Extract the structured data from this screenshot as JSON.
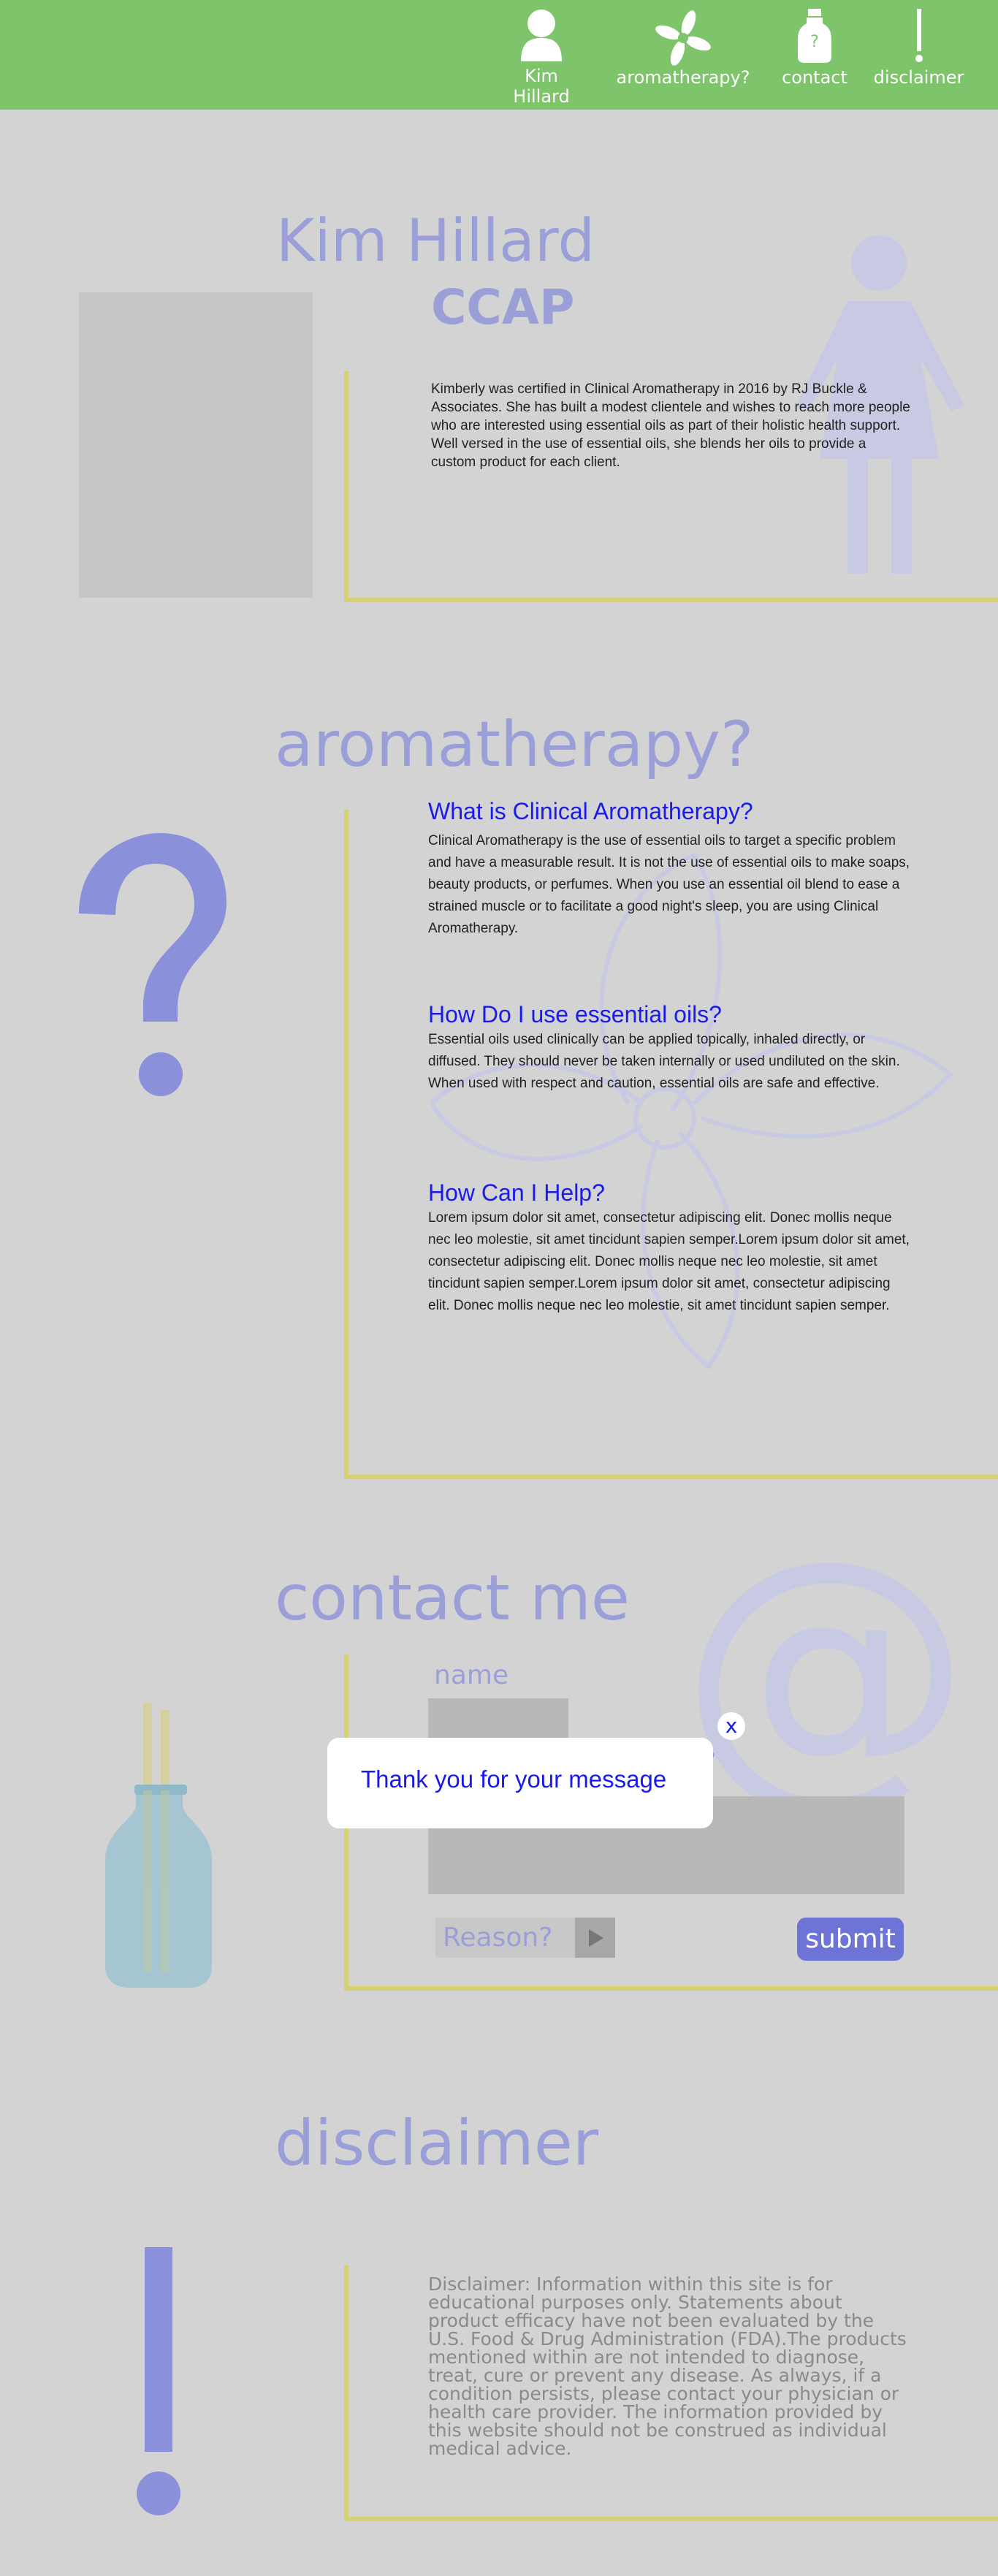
{
  "nav": {
    "items": [
      {
        "label": "Kim Hillard",
        "icon": "person-icon"
      },
      {
        "label": "aromatherapy?",
        "icon": "flower-icon"
      },
      {
        "label": "contact",
        "icon": "bottle-icon"
      },
      {
        "label": "disclaimer",
        "icon": "exclamation-icon"
      }
    ]
  },
  "about": {
    "name": "Kim Hillard",
    "credential": "CCAP",
    "bio": "Kimberly was certified in Clinical Aromatherapy in 2016 by RJ Buckle & Associates. She has built a modest clientele and wishes to reach more people who are interested using essential oils as part of their holistic health support.  Well versed in the use of essential oils, she blends her oils to provide a custom product for each client."
  },
  "aromatherapy": {
    "title": "aromatherapy?",
    "q1": "What is Clinical Aromatherapy?",
    "a1": "Clinical Aromatherapy is the use of essential oils to target a specific problem and have a measurable result. It is not the use of essential oils to make soaps, beauty products, or perfumes. When you use an essential oil blend to ease a strained muscle or to facilitate a good night's sleep, you are using Clinical Aromatherapy.",
    "q2": "How Do I use essential oils?",
    "a2": "Essential oils used clinically can be applied topically, inhaled directly, or diffused. They should never be taken internally or used undiluted on the skin. When used with respect and caution, essential oils are safe and effective.",
    "q3": "How Can I Help?",
    "a3": "Lorem ipsum dolor sit amet, consectetur adipiscing elit. Donec mollis neque nec leo molestie, sit amet tincidunt sapien semper.Lorem ipsum dolor sit amet, consectetur adipiscing elit. Donec mollis neque nec leo molestie, sit amet tincidunt sapien semper.Lorem ipsum dolor sit amet, consectetur adipiscing elit. Donec mollis neque nec leo molestie, sit amet tincidunt sapien semper."
  },
  "contact": {
    "title": "contact me",
    "name_label": "name",
    "message_label_fragment": "?",
    "reason_placeholder": "Reason?",
    "submit_label": "submit"
  },
  "modal": {
    "message": "Thank you for your message",
    "close_label": "x"
  },
  "disclaimer": {
    "title": "disclaimer",
    "text": "Disclaimer: Information within this site is for educational purposes only. Statements about product efficacy have not been evaluated by the U.S. Food & Drug Administration (FDA).The products mentioned within are not intended to diagnose, treat, cure or prevent any disease. As always, if a condition persists, please contact your physician or health care provider. The information provided by this website  should not be construed as individual medical advice."
  },
  "colors": {
    "nav_bg": "#7dc46a",
    "page_bg": "#d3d3d3",
    "title_lavender": "#9b9fd8",
    "accent_yellow": "#d7d271",
    "heading_blue": "#1a1aeb",
    "submit_bg": "#6e74d6"
  }
}
